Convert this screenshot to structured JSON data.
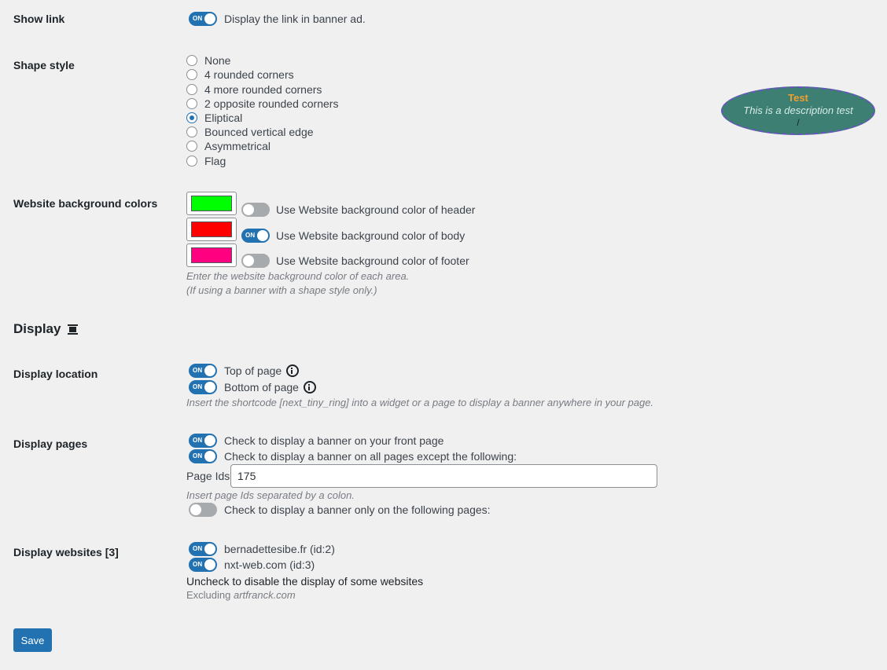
{
  "show_link": {
    "label": "Show link",
    "toggle_state": "on",
    "toggle_text": "ON",
    "text": "Display the link in banner ad."
  },
  "shape_style": {
    "label": "Shape style",
    "options": [
      "None",
      "4 rounded corners",
      "4 more rounded corners",
      "2 opposite rounded corners",
      "Eliptical",
      "Bounced vertical edge",
      "Asymmetrical",
      "Flag"
    ],
    "selected": "Eliptical"
  },
  "preview": {
    "title": "Test",
    "description": "This is a description test",
    "link": "/"
  },
  "bg_colors": {
    "label": "Website background colors",
    "header": {
      "color": "#00ff00",
      "toggle_state": "off",
      "text": "Use Website background color of header"
    },
    "body": {
      "color": "#ff0000",
      "toggle_state": "on",
      "toggle_text": "ON",
      "text": "Use Website background color of body"
    },
    "footer": {
      "color": "#ff0080",
      "toggle_state": "off",
      "text": "Use Website background color of footer"
    },
    "desc1": "Enter the website background color of each area.",
    "desc2": "(If using a banner with a shape style only.)"
  },
  "display_section": {
    "title": "Display"
  },
  "display_location": {
    "label": "Display location",
    "top": {
      "text": "Top of page",
      "toggle_state": "on",
      "toggle_text": "ON"
    },
    "bottom": {
      "text": "Bottom of page",
      "toggle_state": "on",
      "toggle_text": "ON"
    },
    "desc": "Insert the shortcode [next_tiny_ring] into a widget or a page to display a banner anywhere in your page."
  },
  "display_pages": {
    "label": "Display pages",
    "front": {
      "text": "Check to display a banner on your front page",
      "toggle_state": "on",
      "toggle_text": "ON"
    },
    "all_except": {
      "text": "Check to display a banner on all pages except the following:",
      "toggle_state": "on",
      "toggle_text": "ON"
    },
    "page_ids_label": "Page Ids",
    "page_ids_value": "175",
    "page_ids_desc": "Insert page Ids separated by a colon.",
    "only": {
      "text": "Check to display a banner only on the following pages:",
      "toggle_state": "off"
    }
  },
  "display_websites": {
    "label": "Display websites [3]",
    "sites": [
      {
        "text": "bernadettesibe.fr (id:2)",
        "toggle_state": "on",
        "toggle_text": "ON"
      },
      {
        "text": "nxt-web.com (id:3)",
        "toggle_state": "on",
        "toggle_text": "ON"
      }
    ],
    "uncheck_text": "Uncheck to disable the display of some websites",
    "excluding_prefix": "Excluding",
    "excluding_site": "artfranck.com"
  },
  "save_label": "Save",
  "accent_color": "#2271b1"
}
